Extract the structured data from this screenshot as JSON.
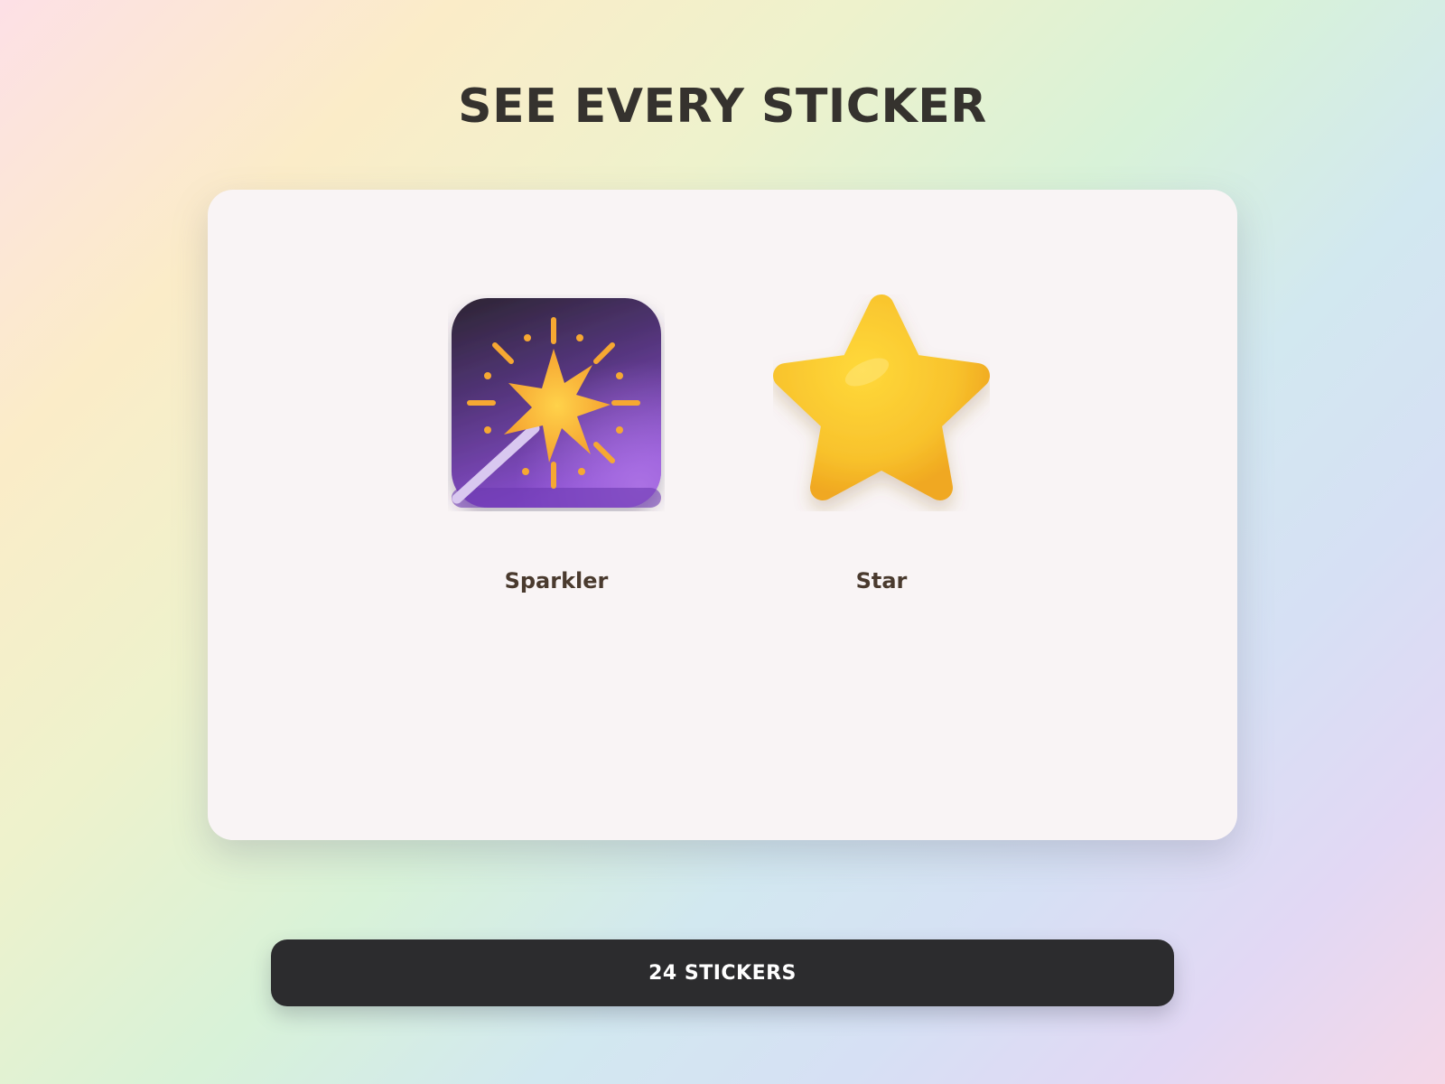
{
  "page": {
    "title": "SEE EVERY STICKER"
  },
  "gallery": {
    "stickers": [
      {
        "label": "Sparkler",
        "icon": "sparkler-icon"
      },
      {
        "label": "Star",
        "icon": "star-icon"
      }
    ]
  },
  "footer": {
    "count_label": "24 STICKERS"
  },
  "colors": {
    "title": "#35322e",
    "card_background": "#f9f4f5",
    "label": "#4a3a2e",
    "bar_background": "#2c2c2e",
    "bar_text": "#ffffff",
    "sparkler_purple": "#7b45c0",
    "sparkler_orange": "#f6a832",
    "star_yellow": "#f8c22c"
  }
}
